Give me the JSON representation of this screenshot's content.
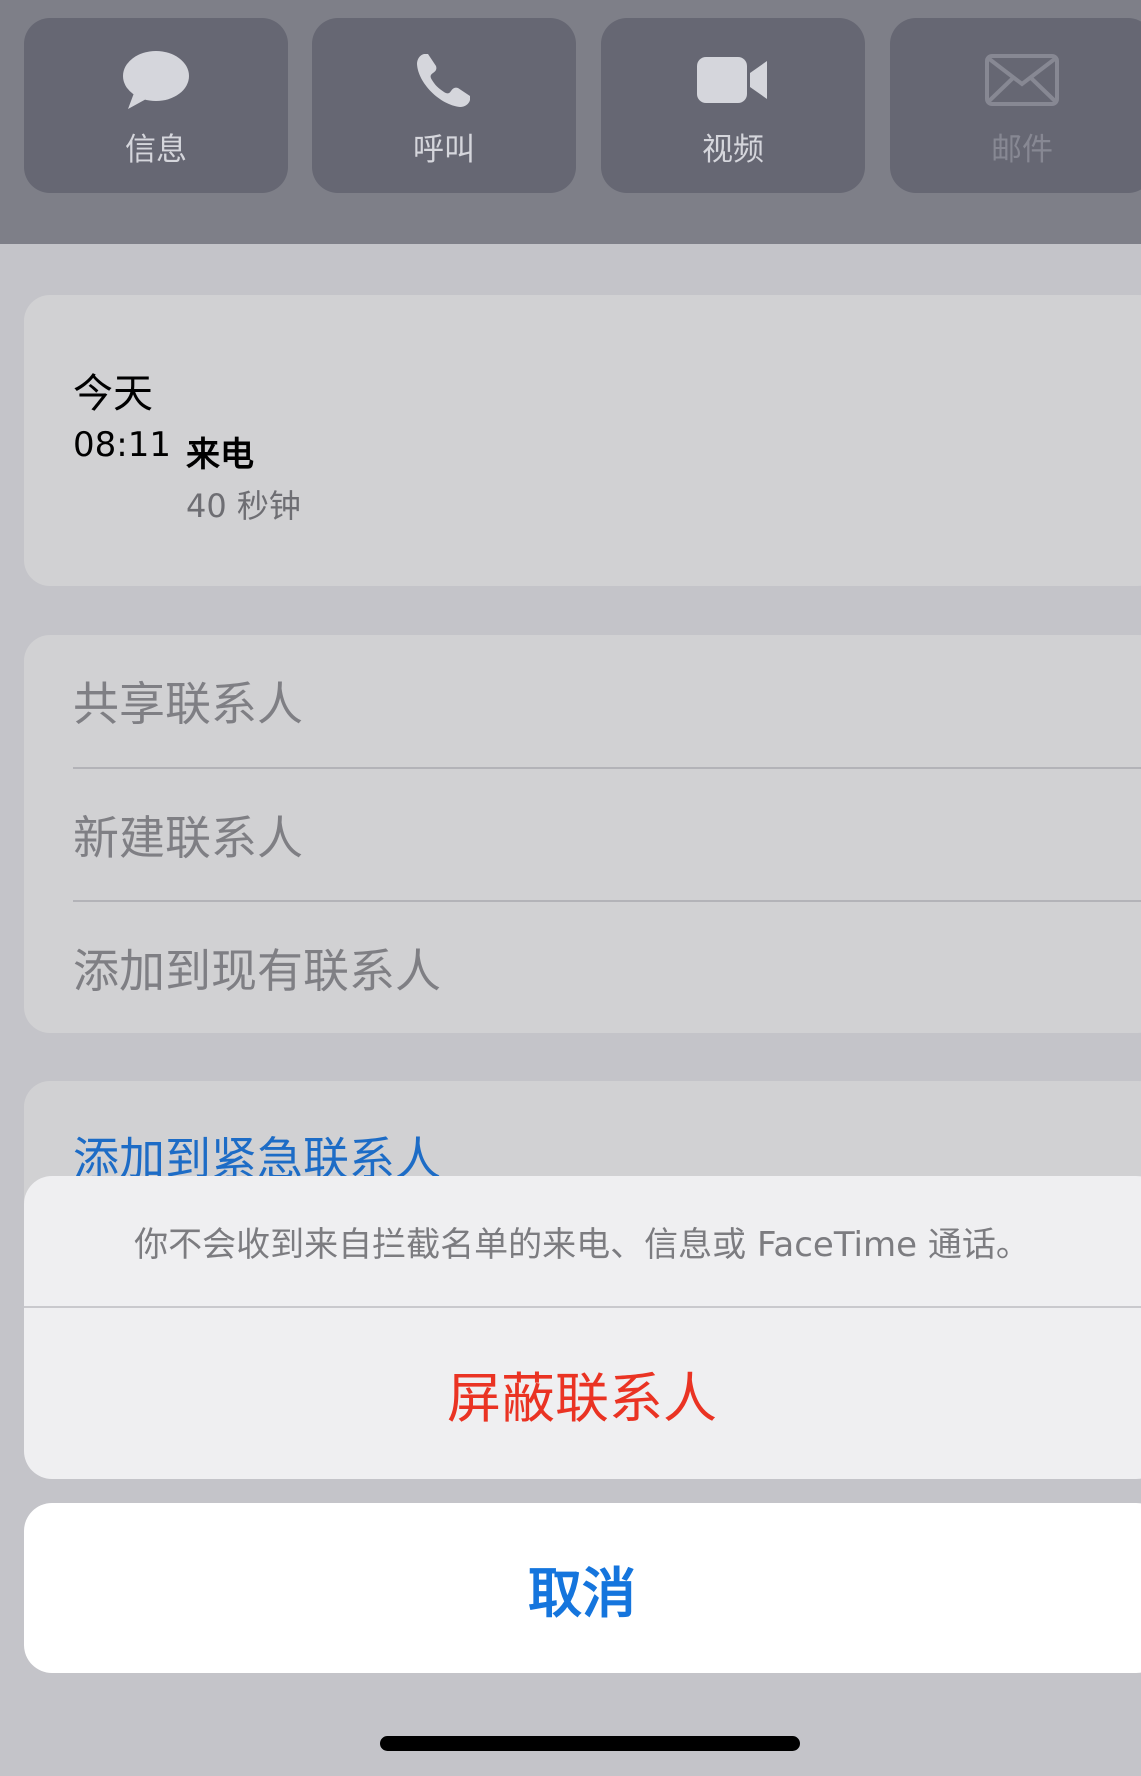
{
  "top_actions": [
    {
      "label": "信息",
      "icon": "message-bubble-icon"
    },
    {
      "label": "呼叫",
      "icon": "phone-icon"
    },
    {
      "label": "视频",
      "icon": "video-camera-icon"
    },
    {
      "label": "邮件",
      "icon": "mail-icon",
      "disabled": true
    }
  ],
  "history": {
    "title": "今天",
    "time": "08:11",
    "type": "来电",
    "duration": "40 秒钟"
  },
  "contact_actions": [
    "共享联系人",
    "新建联系人",
    "添加到现有联系人"
  ],
  "emergency": {
    "label": "添加到紧急联系人"
  },
  "action_sheet": {
    "message": "你不会收到来自拦截名单的来电、信息或 FaceTime 通话。",
    "block_label": "屏蔽联系人",
    "cancel_label": "取消"
  },
  "colors": {
    "destructive": "#ea3323",
    "accent": "#1575dd",
    "link": "#1d6cc6"
  }
}
